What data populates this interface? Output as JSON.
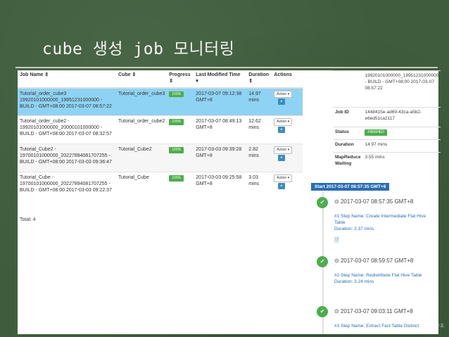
{
  "slide": {
    "title": "cube 생성 job 모니터링",
    "page_number": "2-2."
  },
  "jobs_table": {
    "headers": {
      "job_name": "Job Name ⇕",
      "cube": "Cube ⇕",
      "progress": "Progress",
      "progress_sort": "⇕",
      "last_modified": "Last Modified Time",
      "last_modified_sort": "▾",
      "duration": "Duration",
      "duration_sort": "⇕",
      "actions": "Actions"
    },
    "rows": [
      {
        "job_name": "Tutorial_order_cube3 19920101000000_19951231000000 - BUILD - GMT+08:00 2017-03-07 08:57:22",
        "cube": "Tutorial_order_cube3",
        "progress": "100%",
        "last_modified": "2017-03-07 09:12:38 GMT+8",
        "duration": "14.97 mins",
        "action": "Action ▾",
        "go": "▸"
      },
      {
        "job_name": "Tutorial_order_cube2 - 19920101000000_20000101000000 - BUILD - GMT+08:00 2017-03-07 08:32:57",
        "cube": "Tutorial_order_cube2",
        "progress": "100%",
        "last_modified": "2017-03-07 08:49:13 GMT+8",
        "duration": "12.62 mins",
        "action": "Action ▾",
        "go": "▸"
      },
      {
        "job_name": "Tutorial_Cube2 - 19700101000000_20227894081707255 - BUILD - GMT+08:00 2017-03-03 09:36:47",
        "cube": "Tutorial_Cube2",
        "progress": "100%",
        "last_modified": "2017-03-03 09:39:28 GMT+8",
        "duration": "2.82 mins",
        "action": "Action ▾",
        "go": "▸"
      },
      {
        "job_name": "Tutorial_Cube - 19700101000000_20227894081707255 - BUILD - GMT+08:00 2017-03-03 09:22:37",
        "cube": "Tutorial_Cube",
        "progress": "100%",
        "last_modified": "2017-03-03 09:25:58 GMT+8",
        "duration": "3.03 mins",
        "action": "Action ▾",
        "go": "▸"
      }
    ],
    "total": "Total: 4"
  },
  "details": {
    "top_value": "19920101000000_19951231000000 - BUILD - GMT+08:00 2017-03-07 08:57:22",
    "job_id_label": "Job ID",
    "job_id_value": "1448415e-ad69-43ca-a5b2-e6ed51ca2117",
    "status_label": "Status",
    "status_value": "FINISHED",
    "duration_label": "Duration",
    "duration_value": "14.97 mins",
    "mr_label": "MapReduce Waiting",
    "mr_value": "3.55 mins"
  },
  "timeline": {
    "start_label": "Start  2017-03-07 08:57:35 GMT+8",
    "steps": [
      {
        "time": "2017-03-07 08:57:35 GMT+8",
        "step": "#1 Step Name: Create Intermediate Flat Hive Table",
        "duration": "Duration: 2.37 mins",
        "check": "✔"
      },
      {
        "time": "2017-03-07 08:59:57 GMT+8",
        "step": "#2 Step Name: Redistribute Flat Hive Table",
        "duration": "Duration: 3.24 mins",
        "check": "✔"
      },
      {
        "time": "2017-03-07 09:03:11 GMT+8",
        "step": "#3 Step Name: Extract Fact Table Distinct",
        "check": "✔"
      }
    ],
    "clock_icon": "⊙",
    "doc_icon": "🗎"
  },
  "colors": {
    "board": "#3f5d3d",
    "selected_row": "#8fd3f4",
    "success": "#4cae4c",
    "primary": "#2a6db5"
  }
}
